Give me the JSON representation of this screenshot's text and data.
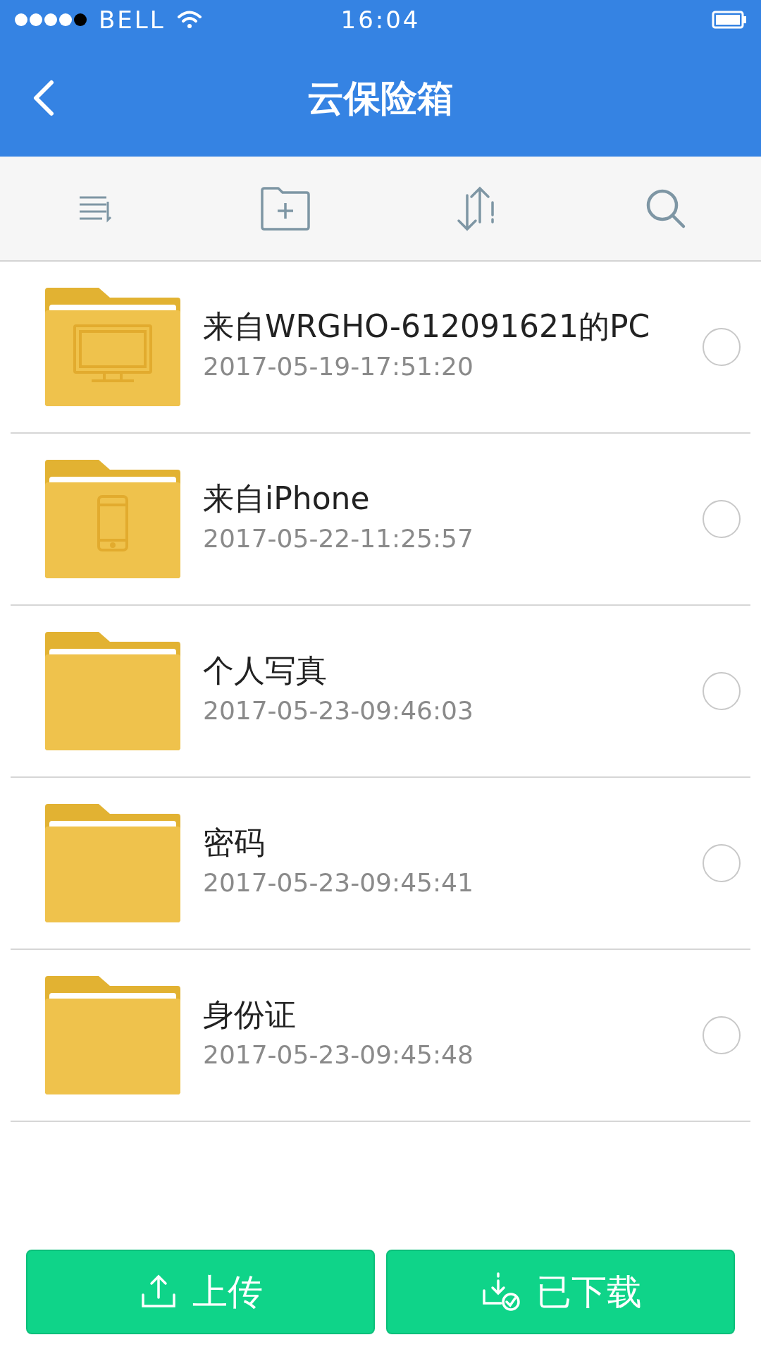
{
  "status_bar": {
    "carrier": "BELL",
    "time": "16:04"
  },
  "header": {
    "title": "云保险箱"
  },
  "files": [
    {
      "name": "来自WRGHO-612091621的PC",
      "date": "2017-05-19-17:51:20",
      "kind": "pc",
      "selected": false
    },
    {
      "name": "来自iPhone",
      "date": "2017-05-22-11:25:57",
      "kind": "phone",
      "selected": false
    },
    {
      "name": "个人写真",
      "date": "2017-05-23-09:46:03",
      "kind": "plain",
      "selected": false
    },
    {
      "name": "密码",
      "date": "2017-05-23-09:45:41",
      "kind": "plain",
      "selected": false
    },
    {
      "name": "身份证",
      "date": "2017-05-23-09:45:48",
      "kind": "plain",
      "selected": false
    }
  ],
  "actions": [
    {
      "label": "上传",
      "kind": "upload"
    },
    {
      "label": "已下载",
      "kind": "downloaded"
    }
  ]
}
